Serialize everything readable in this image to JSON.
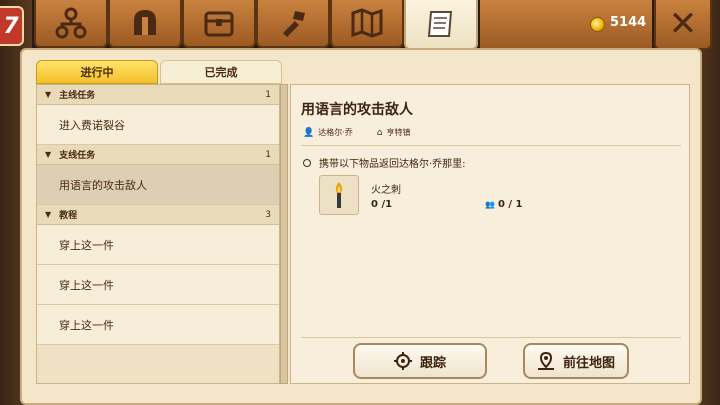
{
  "level_badge": "7",
  "tabs": [
    {
      "icon": "skill-tree-icon",
      "active": false
    },
    {
      "icon": "helmet-icon",
      "active": false
    },
    {
      "icon": "chest-icon",
      "active": false
    },
    {
      "icon": "crafting-icon",
      "active": false
    },
    {
      "icon": "map-icon",
      "active": false
    },
    {
      "icon": "quest-scroll-icon",
      "active": true
    }
  ],
  "currency": {
    "value": "5144",
    "icon": "gold-coin-icon"
  },
  "close_label": "✕",
  "subtabs": {
    "in_progress": "进行中",
    "completed": "已完成"
  },
  "quest_list": {
    "categories": [
      {
        "label": "主线任务",
        "count": "1",
        "items": [
          "进入费诺裂谷"
        ]
      },
      {
        "label": "支线任务",
        "count": "1",
        "items": [
          "用语言的攻击敌人"
        ]
      },
      {
        "label": "教程",
        "count": "3",
        "items": [
          "穿上这一件",
          "穿上这一件",
          "穿上这一件"
        ]
      }
    ]
  },
  "detail": {
    "title": "用语言的攻击敌人",
    "giver": "达格尔·乔",
    "location": "亨特镇",
    "objective": "携带以下物品返回达格尔·乔那里:",
    "reward_item": {
      "name": "火之刺",
      "qty": "0 /1",
      "party_qty": "0 / 1",
      "icon": "torch-icon"
    }
  },
  "buttons": {
    "track": "跟踪",
    "goto_map": "前往地图"
  }
}
